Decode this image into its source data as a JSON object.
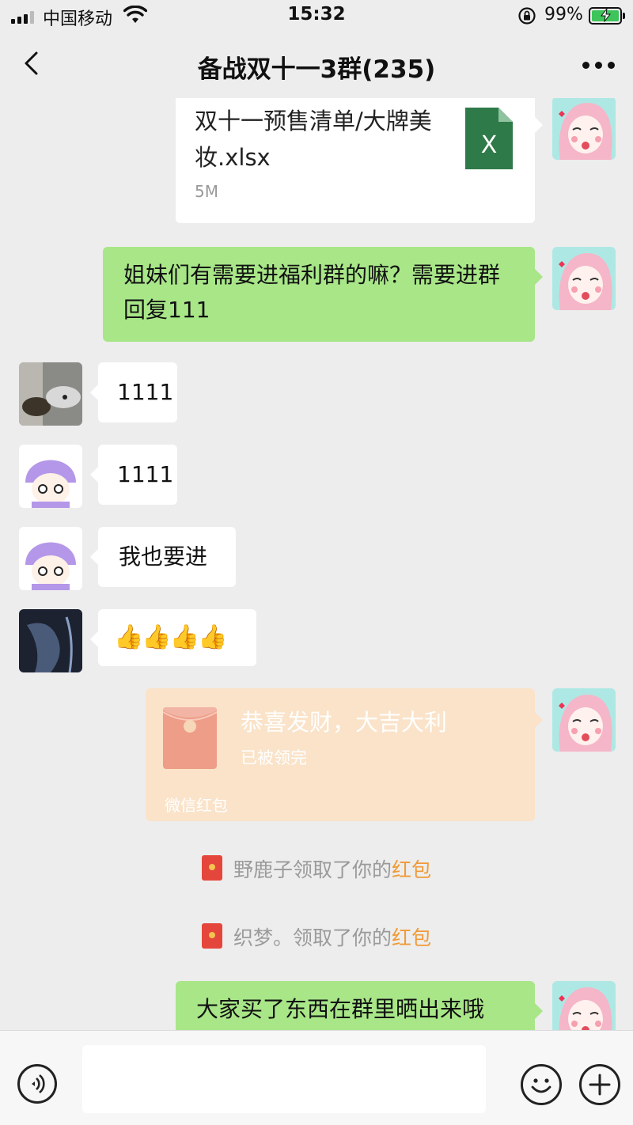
{
  "status_bar": {
    "carrier": "中国移动",
    "time": "15:32",
    "battery": "99%"
  },
  "header": {
    "title": "备战双十一3群(235)"
  },
  "messages": {
    "file": {
      "name": "双十一预售清单/大牌美妆.xlsx",
      "size": "5M",
      "icon_label": "X"
    },
    "m1": "姐妹们有需要进福利群的嘛？需要进群回复111",
    "m2": "1111",
    "m3": "1111",
    "m4": "我也要进",
    "m5": "👍👍👍👍",
    "red_packet": {
      "title": "恭喜发财，大吉大利",
      "status": "已被领完",
      "footer": "微信红包"
    },
    "sys1": {
      "text": "野鹿子领取了你的",
      "link": "红包"
    },
    "sys2": {
      "text": "织梦。领取了你的",
      "link": "红包"
    },
    "m6": "大家买了东西在群里晒出来哦"
  },
  "colors": {
    "green_bubble": "#a8e688",
    "red_packet_bg": "#fae3c9",
    "link": "#f09a37"
  },
  "icons": {
    "back": "chevron-left-icon",
    "more": "ellipsis-icon",
    "voice": "voice-icon",
    "emoji": "smiley-icon",
    "plus": "plus-icon"
  }
}
